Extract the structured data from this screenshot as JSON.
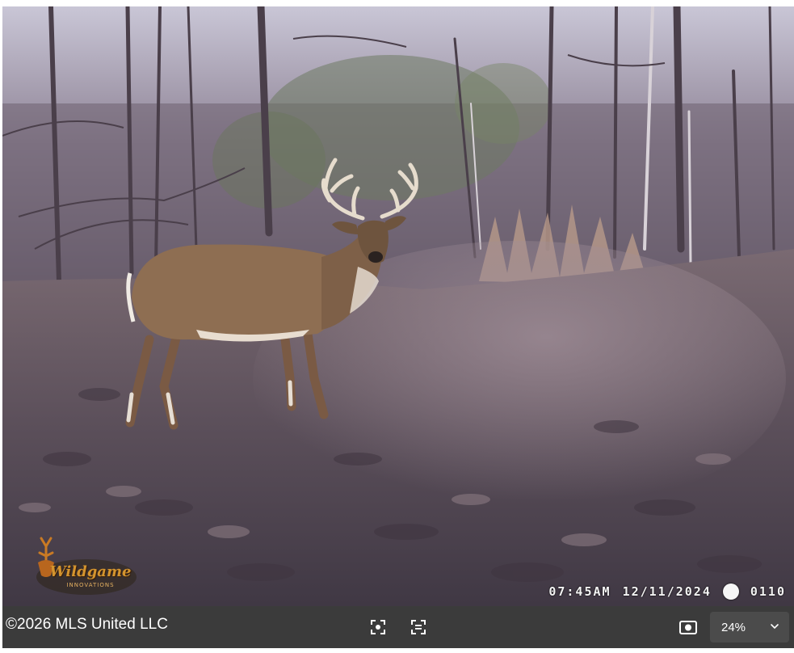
{
  "photo": {
    "alt": "Trail camera photo",
    "overlay": {
      "time": "07:45AM",
      "date": "12/11/2024",
      "moon_phase_icon": "full-moon-icon",
      "counter": "0110"
    },
    "brand": {
      "name": "Wildgame",
      "subtitle": "INNOVATIONS"
    }
  },
  "toolbar": {
    "copyright": "©2026 MLS United LLC",
    "fullscreen_icon": "fullscreen-icon",
    "fit_icon": "fit-to-screen-icon",
    "screenshot_icon": "camera-icon",
    "zoom": {
      "value": "24%",
      "icon": "chevron-down-icon"
    }
  },
  "colors": {
    "toolbar_bg": "#3b3b3b",
    "zoom_bg": "#4b4b4b"
  }
}
